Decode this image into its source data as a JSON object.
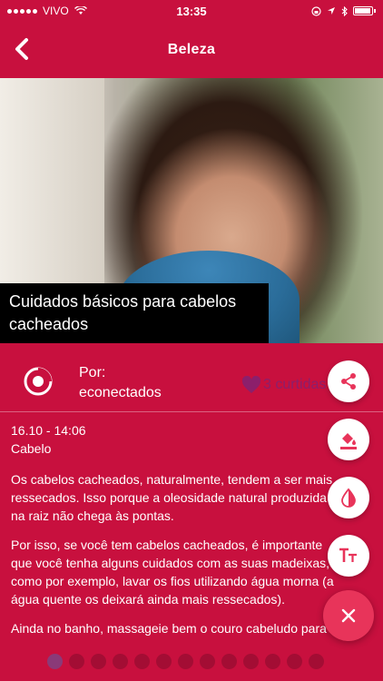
{
  "status_bar": {
    "carrier": "VIVO",
    "time": "13:35"
  },
  "nav": {
    "title": "Beleza",
    "back_icon": "chevron-left-icon"
  },
  "article": {
    "title": "Cuidados básicos para cabelos cacheados",
    "author_prefix": "Por:",
    "author": "econectados",
    "likes": "3 curtidas",
    "date": "16.10 - 14:06",
    "category": "Cabelo",
    "paragraphs": [
      [
        "Os cabelos cacheados, naturalmente, tendem a ser mais",
        "ressecados. Isso porque a oleosidade natural produzida",
        "na raiz não chega às pontas."
      ],
      [
        "Por isso, se você tem cabelos cacheados, é importante",
        "que você tenha alguns cuidados com as suas madeixas,",
        "como por exemplo, lavar os fios utilizando água morna (a",
        "água quente os deixará ainda mais ressecados)."
      ],
      [
        "Ainda no banho, massageie bem o couro cabeludo para"
      ]
    ]
  },
  "actions": [
    {
      "name": "share",
      "icon": "share-icon"
    },
    {
      "name": "background-color",
      "icon": "paint-bucket-icon"
    },
    {
      "name": "contrast",
      "icon": "contrast-icon"
    },
    {
      "name": "font-size",
      "icon": "text-size-icon"
    }
  ],
  "close_icon": "close-icon",
  "pager": {
    "total": 13,
    "current": 1
  },
  "colors": {
    "background": "#c8103e",
    "accent": "#e8345a",
    "like": "#8c1f6b"
  }
}
